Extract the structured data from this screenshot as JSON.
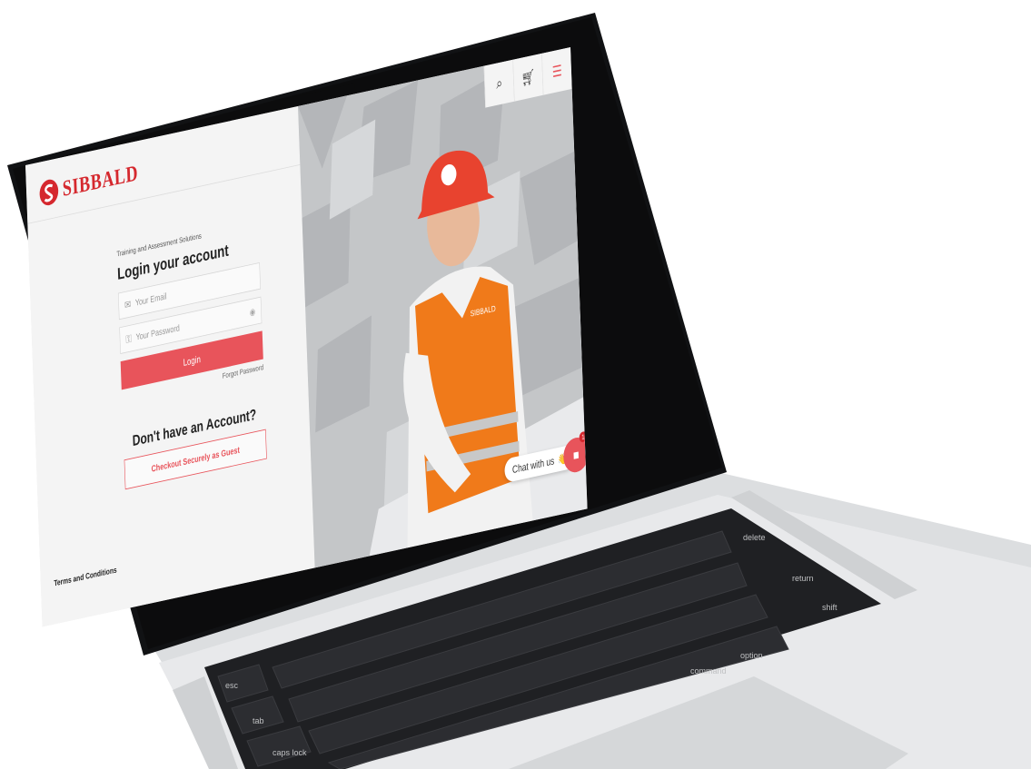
{
  "brand": {
    "name": "SIBBALD"
  },
  "login": {
    "tagline": "Training and Assessment Solutions",
    "title": "Login your account",
    "email_placeholder": "Your Email",
    "password_placeholder": "Your Password",
    "login_label": "Login",
    "forgot_label": "Forgot Password",
    "no_account": "Don't have an Account?",
    "guest_label": "Checkout Securely as Guest"
  },
  "footer": {
    "terms": "Terms and Conditions"
  },
  "topbar": {
    "icons": [
      "search-icon",
      "cart-icon",
      "menu-icon"
    ]
  },
  "chat": {
    "label": "Chat with us",
    "emoji": "👋",
    "badge": "1"
  },
  "hero": {
    "vest_text": "SIBBALD"
  },
  "keyboard": {
    "esc": "esc",
    "tab": "tab",
    "caps": "caps lock",
    "shift": "shift",
    "command": "command",
    "option": "option",
    "delete": "delete",
    "return": "return"
  },
  "colors": {
    "accent": "#e8545b",
    "brand_red": "#d5282e",
    "vest": "#f07a1a"
  }
}
